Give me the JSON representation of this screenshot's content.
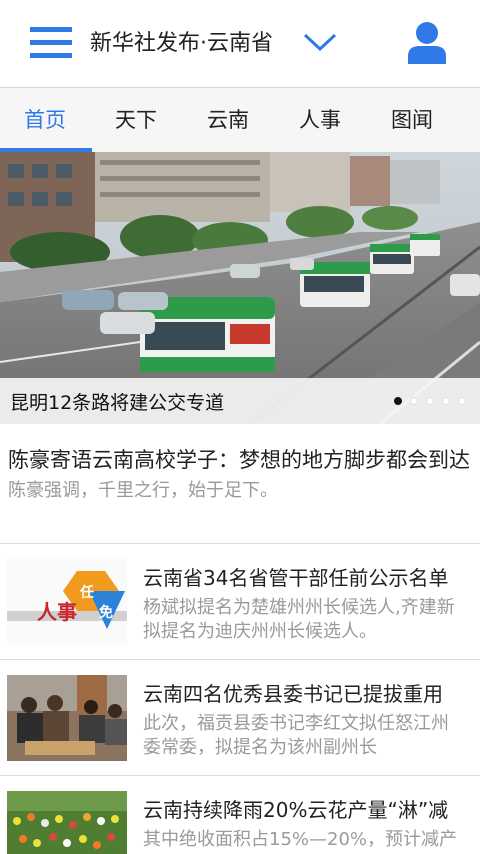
{
  "header": {
    "menu_icon": "hamburger-menu-icon",
    "title": "新华社发布·云南省",
    "dropdown_icon": "chevron-down-icon",
    "user_icon": "user-profile-icon",
    "accent_color": "#2f79e8"
  },
  "tabs": [
    {
      "label": "首页",
      "active": true
    },
    {
      "label": "天下",
      "active": false
    },
    {
      "label": "云南",
      "active": false
    },
    {
      "label": "人事",
      "active": false
    },
    {
      "label": "图闻",
      "active": false
    }
  ],
  "banner": {
    "caption": "昆明12条路将建公交专道",
    "slide_count": 5,
    "active_slide": 1
  },
  "lead_article": {
    "title": "陈豪寄语云南高校学子：梦想的地方脚步都会到达",
    "summary": "陈豪强调，千里之行，始于足下。"
  },
  "news_list": [
    {
      "title": "云南省34名省管干部任前公示名单",
      "summary": "杨斌拟提名为楚雄州州长候选人,齐建新拟提名为迪庆州州长候选人。",
      "thumb_label_left": "人事",
      "thumb_label_right_top": "任",
      "thumb_label_right_bottom": "免"
    },
    {
      "title": "云南四名优秀县委书记已提拔重用",
      "summary": "此次，福贡县委书记李红文拟任怒江州委常委，拟提名为该州副州长"
    },
    {
      "title": "云南持续降雨20%云花产量“淋”减",
      "summary": "其中绝收面积占15%—20%，预计减产"
    }
  ]
}
